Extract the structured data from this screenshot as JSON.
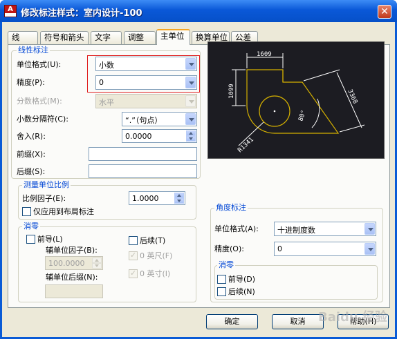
{
  "title": "修改标注样式：室内设计-100",
  "title_icon_letter": "A",
  "close_glyph": "✕",
  "tabs": [
    "线",
    "符号和箭头",
    "文字",
    "调整",
    "主单位",
    "换算单位",
    "公差"
  ],
  "active_tab": "主单位",
  "linear": {
    "legend": "线性标注",
    "unit_format_label": "单位格式(U):",
    "unit_format_value": "小数",
    "precision_label": "精度(P):",
    "precision_value": "0",
    "fraction_label": "分数格式(M):",
    "fraction_value": "水平",
    "decimal_sep_label": "小数分隔符(C):",
    "decimal_sep_value": "“.”（句点）",
    "round_label": "舍入(R):",
    "round_value": "0.0000",
    "prefix_label": "前缀(X):",
    "prefix_value": "",
    "suffix_label": "后缀(S):",
    "suffix_value": ""
  },
  "scale": {
    "legend": "测量单位比例",
    "factor_label": "比例因子(E):",
    "factor_value": "1.0000",
    "layout_only_label": "仅应用到布局标注"
  },
  "zero_linear": {
    "legend": "消零",
    "leading_label": "前导(L)",
    "trailing_label": "后续(T)",
    "sub_factor_label": "辅单位因子(B):",
    "sub_factor_value": "100.0000",
    "sub_suffix_label": "辅单位后缀(N):",
    "feet_label": "0 英尺(F)",
    "inches_label": "0 英寸(I)"
  },
  "angular": {
    "legend": "角度标注",
    "unit_format_label": "单位格式(A):",
    "unit_format_value": "十进制度数",
    "precision_label": "精度(O):",
    "precision_value": "0",
    "zero_legend": "消零",
    "leading_label": "前导(D)",
    "trailing_label": "后续(N)"
  },
  "preview": {
    "dim_top": "1609",
    "dim_left": "1099",
    "dim_right": "3368",
    "dim_diag": "R1341",
    "dim_angle": "80°"
  },
  "buttons": {
    "ok": "确定",
    "cancel": "取消",
    "help": "帮助(H)"
  },
  "watermark": "Baidu 经验",
  "colors": {
    "title_bar": "#0a58d8",
    "preview_bg": "#1c1c22",
    "geometry": "#d4b000",
    "dims": "#ffffff",
    "highlight": "#e02020"
  }
}
